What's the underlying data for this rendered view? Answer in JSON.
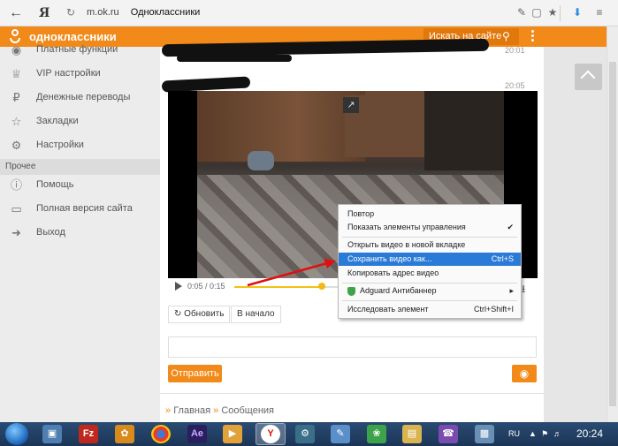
{
  "browser": {
    "back_icon": "arrow-left-icon",
    "yandex_label": "Я",
    "reload_icon": "reload-icon",
    "url_domain": "m.ok.ru",
    "page_title": "Одноклассники",
    "tools": [
      "pen-icon",
      "reader-icon",
      "star-icon",
      "download-icon",
      "menu-icon"
    ]
  },
  "header": {
    "brand": "одноклассники",
    "search_placeholder": "Искать на сайте",
    "accent": "#f28a1a"
  },
  "sidebar": {
    "items": [
      {
        "label": "Платные функции",
        "icon": "coins-icon"
      },
      {
        "label": "VIP настройки",
        "icon": "crown-icon"
      },
      {
        "label": "Денежные переводы",
        "icon": "ruble-icon"
      },
      {
        "label": "Закладки",
        "icon": "star-icon"
      },
      {
        "label": "Настройки",
        "icon": "gear-icon"
      }
    ],
    "section": "Прочее",
    "items2": [
      {
        "label": "Помощь",
        "icon": "question-icon"
      },
      {
        "label": "Полная версия сайта",
        "icon": "monitor-icon"
      },
      {
        "label": "Выход",
        "icon": "exit-icon"
      }
    ]
  },
  "messages": {
    "time1": "20:01",
    "time2": "20:05"
  },
  "player": {
    "time": "0:05 / 0:15",
    "progress": 0.33
  },
  "actions": {
    "refresh": "Обновить",
    "to_start": "В начало",
    "send": "Отправить"
  },
  "footer": {
    "crumb1": "Главная",
    "crumb2": "Сообщения"
  },
  "context_menu": {
    "items": [
      {
        "label": "Повтор",
        "key": ""
      },
      {
        "label": "Показать элементы управления",
        "key": "✔"
      },
      {
        "label": "Открыть видео в новой вкладке",
        "key": ""
      },
      {
        "label": "Сохранить видео как...",
        "key": "Ctrl+S"
      },
      {
        "label": "Копировать адрес видео",
        "key": ""
      },
      {
        "label": "Adguard Антибаннер",
        "key": "▸"
      },
      {
        "label": "Исследовать элемент",
        "key": "Ctrl+Shift+I"
      }
    ]
  },
  "taskbar": {
    "lang": "RU",
    "clock": "20:24"
  }
}
